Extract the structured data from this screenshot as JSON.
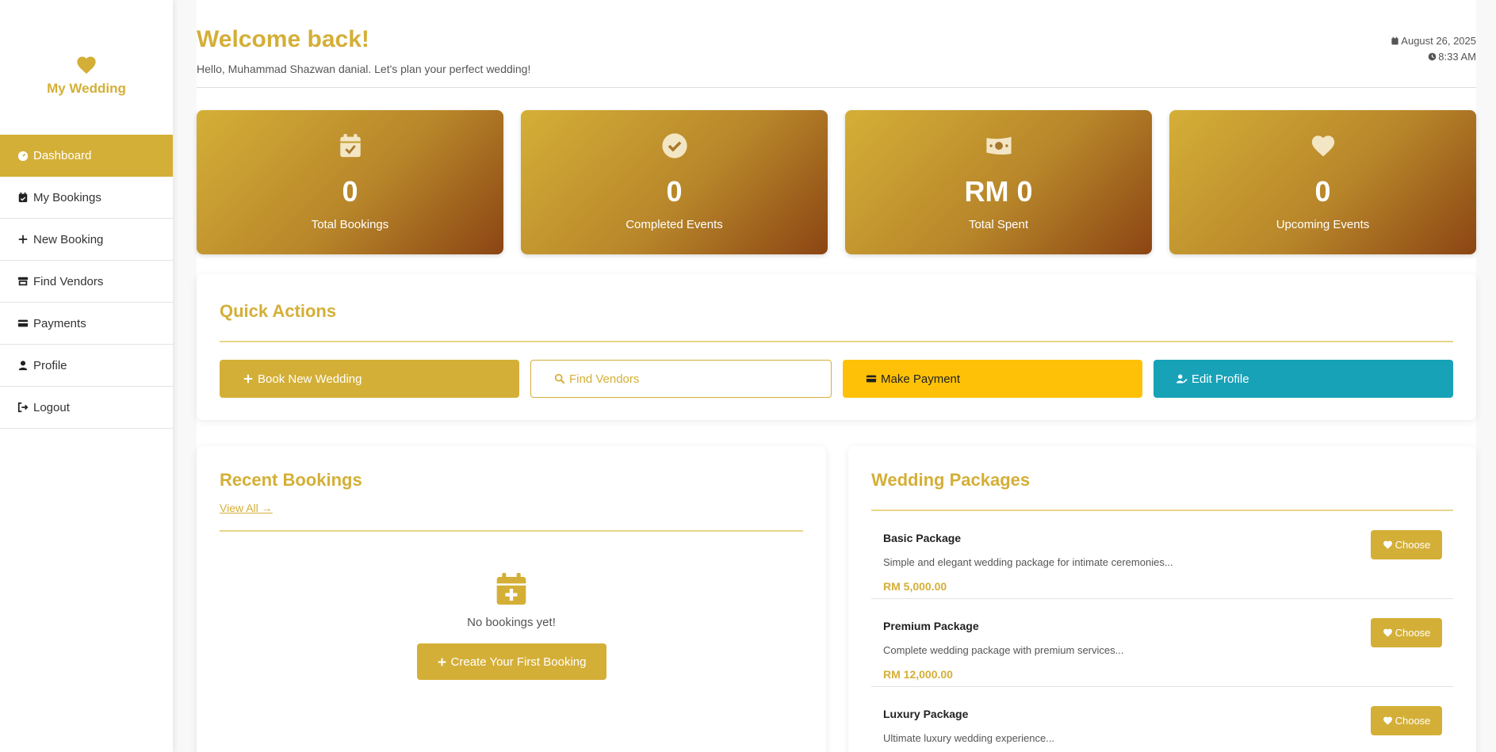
{
  "brand": {
    "name": "My Wedding"
  },
  "sidebar": {
    "items": [
      {
        "label": "Dashboard",
        "icon": "dashboard-icon",
        "active": true
      },
      {
        "label": "My Bookings",
        "icon": "calendar-check-icon"
      },
      {
        "label": "New Booking",
        "icon": "plus-icon"
      },
      {
        "label": "Find Vendors",
        "icon": "store-icon"
      },
      {
        "label": "Payments",
        "icon": "credit-card-icon"
      },
      {
        "label": "Profile",
        "icon": "user-icon"
      },
      {
        "label": "Logout",
        "icon": "logout-icon"
      }
    ]
  },
  "header": {
    "title": "Welcome back!",
    "subtitle": "Hello, Muhammad Shazwan danial. Let's plan your perfect wedding!",
    "date": "August 26, 2025",
    "time": "8:33 AM"
  },
  "stats": [
    {
      "value": "0",
      "label": "Total Bookings",
      "icon": "calendar-check-icon"
    },
    {
      "value": "0",
      "label": "Completed Events",
      "icon": "check-circle-icon"
    },
    {
      "value": "RM 0",
      "label": "Total Spent",
      "icon": "money-bill-icon"
    },
    {
      "value": "0",
      "label": "Upcoming Events",
      "icon": "heart-icon"
    }
  ],
  "quick_actions": {
    "title": "Quick Actions",
    "buttons": [
      {
        "label": "Book New Wedding",
        "icon": "plus-icon"
      },
      {
        "label": "Find Vendors",
        "icon": "search-icon"
      },
      {
        "label": "Make Payment",
        "icon": "credit-card-icon"
      },
      {
        "label": "Edit Profile",
        "icon": "user-edit-icon"
      }
    ]
  },
  "recent_bookings": {
    "title": "Recent Bookings",
    "view_all": "View All →",
    "empty_message": "No bookings yet!",
    "create_button": "Create Your First Booking"
  },
  "packages": {
    "title": "Wedding Packages",
    "choose_label": "Choose",
    "items": [
      {
        "name": "Basic Package",
        "description": "Simple and elegant wedding package for intimate ceremonies...",
        "price": "RM 5,000.00"
      },
      {
        "name": "Premium Package",
        "description": "Complete wedding package with premium services...",
        "price": "RM 12,000.00"
      },
      {
        "name": "Luxury Package",
        "description": "Ultimate luxury wedding experience...",
        "price": ""
      }
    ]
  },
  "colors": {
    "gold": "#d4af37",
    "brown": "#8b4513",
    "yellow": "#ffc107",
    "teal": "#17a2b8"
  }
}
